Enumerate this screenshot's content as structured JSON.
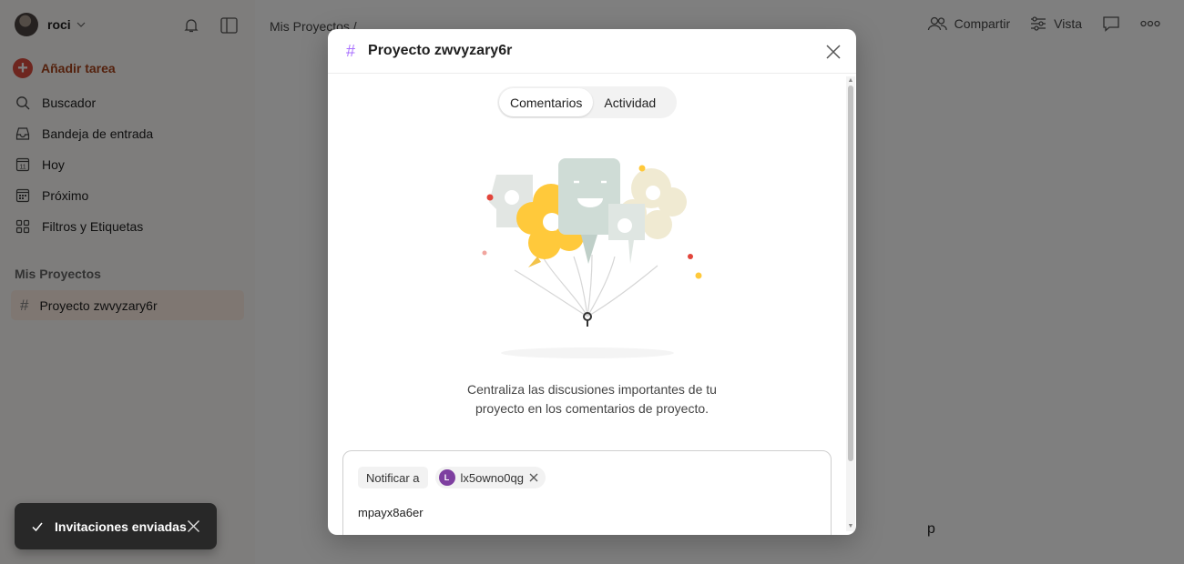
{
  "sidebar": {
    "user": {
      "name": "roci",
      "avatar_icon": "user-avatar"
    },
    "add_task": "Añadir tarea",
    "nav": [
      {
        "label": "Buscador",
        "icon": "search-icon"
      },
      {
        "label": "Bandeja de entrada",
        "icon": "inbox-icon"
      },
      {
        "label": "Hoy",
        "icon": "calendar-today-icon"
      },
      {
        "label": "Próximo",
        "icon": "calendar-upcoming-icon"
      },
      {
        "label": "Filtros y Etiquetas",
        "icon": "filters-icon"
      }
    ],
    "section_title": "Mis Proyectos",
    "projects": [
      {
        "label": "Proyecto zwvyzary6r",
        "icon": "hash-icon"
      }
    ]
  },
  "main": {
    "breadcrumb": "Mis Proyectos /",
    "actions": {
      "share": "Compartir",
      "view": "Vista"
    }
  },
  "modal": {
    "title": "Proyecto zwvyzary6r",
    "tabs": [
      {
        "label": "Comentarios",
        "active": true
      },
      {
        "label": "Actividad",
        "active": false
      }
    ],
    "empty_text": "Centraliza las discusiones importantes de tu proyecto en los comentarios de proyecto.",
    "notify_label": "Notificar a",
    "notify_chip": {
      "initial": "L",
      "name": "lx5owno0qg"
    },
    "comment_text": "mpayx8a6er"
  },
  "toast": {
    "text": "Invitaciones enviadas"
  },
  "colors": {
    "accent": "#dc4c3e",
    "project_hash": "#a970ff",
    "toast_bg": "#282828",
    "overlay": "rgba(0,0,0,0.5)"
  }
}
